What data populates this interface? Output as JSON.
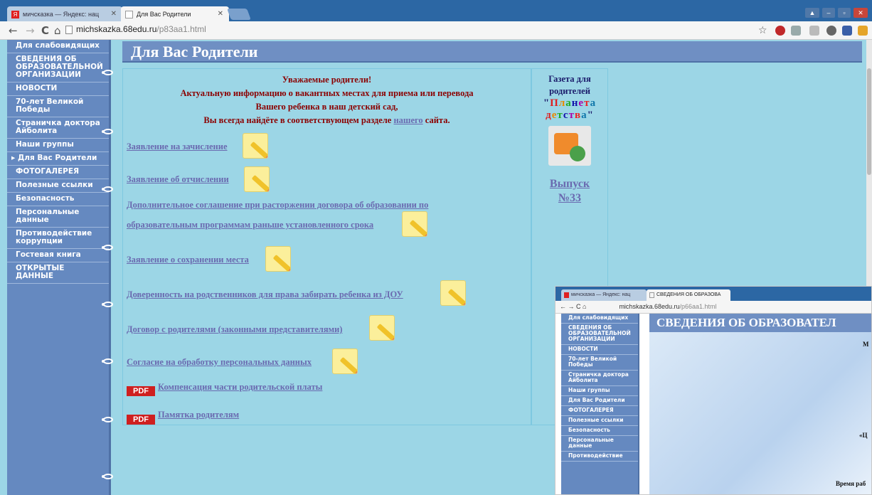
{
  "browser": {
    "tabs": [
      {
        "label": "мичсказка — Яндекс: нац",
        "active": false
      },
      {
        "label": "Для Вас Родители",
        "active": true
      }
    ],
    "url_host": "michskazka.68edu.ru",
    "url_path": "/p83aa1.html"
  },
  "sidebar": {
    "items": [
      "Для слабовидящих",
      "СВЕДЕНИЯ ОБ ОБРАЗОВАТЕЛЬНОЙ ОРГАНИЗАЦИИ",
      "НОВОСТИ",
      "70-лет Великой Победы",
      "Страничка доктора Айболита",
      "Наши группы",
      "Для Вас Родители",
      "ФОТОГАЛЕРЕЯ",
      "Полезные ссылки",
      "Безопасность",
      "Персональные данные",
      "Противодействие коррупции",
      "Гостевая книга",
      "ОТКРЫТЫЕ ДАННЫЕ"
    ],
    "current_index": 6
  },
  "page": {
    "title": "Для Вас Родители",
    "intro": {
      "line1": "Уважаемые родители!",
      "line2": "Актуальную информацию о вакантных местах для приема или перевода",
      "line3": "Вашего ребенка в наш детский сад,",
      "line4_before": "Вы всегда найдёте в соответствующем разделе",
      "line4_link": "нашего",
      "line4_after": "сайта."
    },
    "documents": [
      "Заявление на зачисление",
      "Заявление об отчислении",
      "Дополнительное соглашение при расторжении договора об образовании по",
      "образовательным программам раньше установленного срока",
      "Заявление о сохранении места",
      "Доверенность на родственников для права забирать ребенка из ДОУ",
      "Договор с родителями (законными представителями)",
      "Согласие на обработку персональных данных"
    ],
    "pdf_links": [
      "Компенсация части родительской платы",
      "Памятка родителям"
    ],
    "pdf_badge": "PDF"
  },
  "newspaper": {
    "line1": "Газета для",
    "line2": "родителей",
    "planeta": [
      "П",
      "л",
      "а",
      "н",
      "е",
      "т",
      "а"
    ],
    "detstva": [
      "д",
      "е",
      "т",
      "с",
      "т",
      "в",
      "а"
    ],
    "quote": "\"",
    "issue_word": "Выпуск",
    "issue_number": "№33"
  },
  "overlay": {
    "tabs": [
      "мичсказка — Яндекс: нац",
      "СВЕДЕНИЯ ОБ ОБРАЗОВА"
    ],
    "url_host": "michskazka.68edu.ru",
    "url_path": "/p66aa1.html",
    "sidebar": [
      "Для слабовидящих",
      "СВЕДЕНИЯ ОБ ОБРАЗОВАТЕЛЬНОЙ ОРГАНИЗАЦИИ",
      "НОВОСТИ",
      "70-лет Великой Победы",
      "Страничка доктора Айболита",
      "Наши группы",
      "Для Вас Родители",
      "ФОТОГАЛЕРЕЯ",
      "Полезные ссылки",
      "Безопасность",
      "Персональные данные",
      "Противодействие"
    ],
    "title": "СВЕДЕНИЯ ОБ ОБРАЗОВАТЕЛ",
    "fragments": [
      "М",
      "«Ц",
      "Время раб"
    ]
  },
  "colors": {
    "background": "#9cd6e6",
    "sidebar": "#6589c0",
    "header": "#6f8fc3",
    "intro_text": "#8b0000",
    "link": "#6a6ab0",
    "tabbar": "#2c67a4",
    "planeta_letters": [
      "#d22",
      "#e88a00",
      "#2a2",
      "#11a",
      "#a0a",
      "#e22",
      "#17a"
    ],
    "detstva_letters": [
      "#d22",
      "#e88a00",
      "#2a2",
      "#11a",
      "#a0a",
      "#e22",
      "#17a"
    ]
  }
}
